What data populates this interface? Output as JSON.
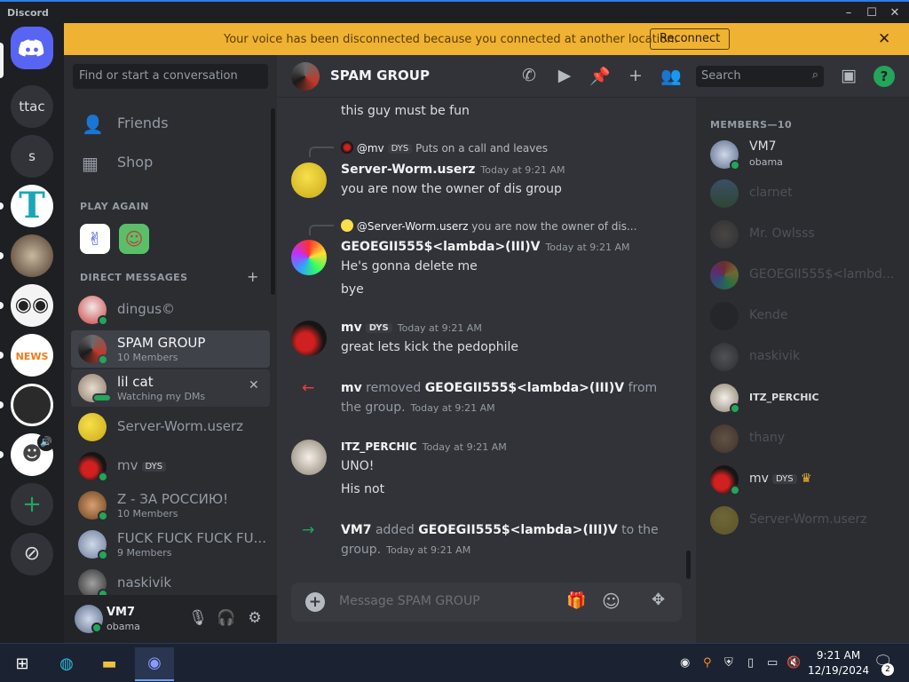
{
  "window": {
    "title": "Discord"
  },
  "servers": {
    "ttac": "ttac",
    "s": "s",
    "add": "+"
  },
  "banner": {
    "text": "Your voice has been disconnected because you connected at another location.",
    "button": "Reconnect"
  },
  "sidebar": {
    "search_placeholder": "Find or start a conversation",
    "friends": "Friends",
    "shop": "Shop",
    "play_again": "PLAY AGAIN",
    "direct_messages": "DIRECT MESSAGES",
    "dms": [
      {
        "name": "dingus©",
        "sub": ""
      },
      {
        "name": "SPAM GROUP",
        "sub": "10 Members"
      },
      {
        "name": "lil cat",
        "sub": "Watching my DMs"
      },
      {
        "name": "Server-Worm.userz",
        "sub": ""
      },
      {
        "name": "mv",
        "tag": "DYS",
        "sub": ""
      },
      {
        "name": "Z - ЗА РОССИЮ!",
        "sub": "10 Members"
      },
      {
        "name": "FUCK FUCK FUCK FU...",
        "sub": "9 Members"
      },
      {
        "name": "naskivik",
        "sub": ""
      }
    ]
  },
  "user": {
    "name": "VM7",
    "status": "obama"
  },
  "header": {
    "title": "SPAM GROUP",
    "search": "Search"
  },
  "messages": {
    "m0": {
      "text": "this guy must be fun"
    },
    "m1": {
      "reply_user": "@mv",
      "reply_tag": "DYS",
      "reply_text": "Puts on a call and leaves",
      "author": "Server-Worm.userz",
      "time": "Today at 9:21 AM",
      "text": "you are now the owner of dis group"
    },
    "m2": {
      "reply_user": "@Server-Worm.userz",
      "reply_text": "you are now the owner of dis...",
      "author": "GEOEGII555$<lambda>(III)V",
      "time": "Today at 9:21 AM",
      "lines": [
        "He's gonna delete me",
        "bye"
      ]
    },
    "m3": {
      "author": "mv",
      "tag": "DYS",
      "time": "Today at 9:21 AM",
      "text": "great lets kick the pedophile"
    },
    "sys1": {
      "actor": "mv",
      "verb": "removed",
      "target": "GEOEGII555$<lambda>(III)V",
      "tail": "from the group.",
      "time": "Today at 9:21 AM"
    },
    "m4": {
      "author": "ITZ_PERCHIC",
      "time": "Today at 9:21 AM",
      "lines": [
        "UNO!",
        "His not"
      ]
    },
    "sys2": {
      "actor": "VM7",
      "verb": "added",
      "target": "GEOEGII555$<lambda>(III)V",
      "tail": "to the group.",
      "time": "Today at 9:21 AM"
    }
  },
  "compose": {
    "placeholder": "Message SPAM GROUP"
  },
  "members": {
    "header": "MEMBERS—10",
    "list": [
      {
        "name": "VM7",
        "sub": "obama",
        "online": true
      },
      {
        "name": "clarnet",
        "online": false
      },
      {
        "name": "Mr. Owlsss",
        "online": false
      },
      {
        "name": "GEOEGII555$<lambd...",
        "online": false
      },
      {
        "name": "Kende",
        "online": false
      },
      {
        "name": "naskivik",
        "online": false
      },
      {
        "name": "ITZ_PERCHIC",
        "online": true
      },
      {
        "name": "thany",
        "online": false
      },
      {
        "name": "mv",
        "tag": "DYS",
        "online": true
      },
      {
        "name": "Server-Worm.userz",
        "online": false
      }
    ]
  },
  "taskbar": {
    "time": "9:21 AM",
    "date": "12/19/2024",
    "notifications": "2"
  },
  "colors": {
    "brand": "#5865f2",
    "banner": "#f0b232",
    "online": "#23a55a",
    "removed": "#f23f43",
    "added": "#23a55a"
  }
}
